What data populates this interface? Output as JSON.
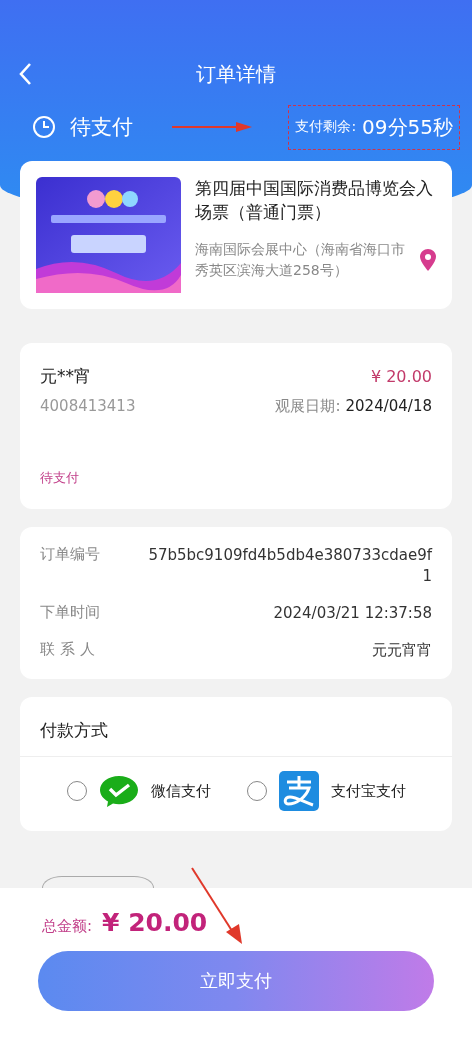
{
  "header": {
    "title": "订单详情",
    "status": "待支付",
    "countdown_label": "支付剩余:",
    "countdown": "09分55秒"
  },
  "ticket": {
    "name": "第四届中国国际消费品博览会入场票（普通门票）",
    "address": "海南国际会展中心（海南省海口市秀英区滨海大道258号）"
  },
  "visitor": {
    "name": "元**宵",
    "price": "¥ 20.00",
    "id_number": "4008413413",
    "date_label": "观展日期:",
    "date": "2024/04/18",
    "status": "待支付"
  },
  "order_info": [
    {
      "label": "订单编号",
      "value": "57b5bc9109fd4b5db4e380733cdae9f1"
    },
    {
      "label": "下单时间",
      "value": "2024/03/21 12:37:58"
    },
    {
      "label": "联 系 人",
      "value": "元元宵宵"
    }
  ],
  "payment": {
    "title": "付款方式",
    "methods": [
      {
        "kind": "wechat",
        "label": "微信支付",
        "selected": false
      },
      {
        "kind": "alipay",
        "label": "支付宝支付",
        "selected": false
      }
    ]
  },
  "footer": {
    "total_label": "总金额:",
    "total": "¥ 20.00",
    "pay_button": "立即支付"
  }
}
